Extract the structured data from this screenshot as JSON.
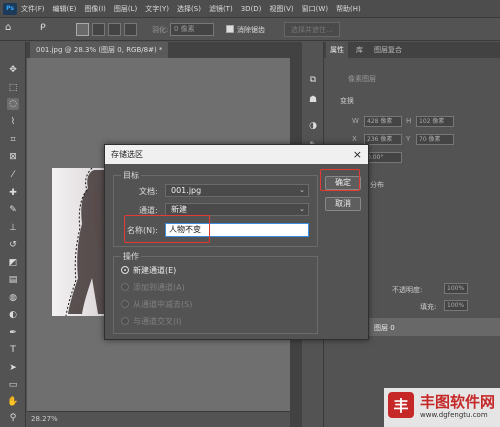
{
  "app": {
    "logo": "Ps",
    "menu": [
      "文件(F)",
      "编辑(E)",
      "图像(I)",
      "图层(L)",
      "文字(Y)",
      "选择(S)",
      "滤镜(T)",
      "3D(D)",
      "视图(V)",
      "窗口(W)",
      "帮助(H)"
    ]
  },
  "options_bar": {
    "feather_label": "羽化:",
    "feather_value": "0 像素",
    "antialias_label": "消除锯齿",
    "antialias_checked": true,
    "select_subject_label": "选择并遮住..."
  },
  "document": {
    "tab_title": "001.jpg @ 28.3% (图层 0, RGB/8#) *",
    "zoom": "28.27%"
  },
  "right_panel": {
    "tabs": [
      "属性",
      "库",
      "图层复合"
    ],
    "pixel_layer_label": "像素图层",
    "transform_label": "变换",
    "w": "428 像素",
    "h": "102 像素",
    "x": "236 像素",
    "y": "70 像素",
    "angle": "0.00°",
    "align_label": "分布",
    "opacity_label": "不透明度:",
    "opacity_value": "100%",
    "fill_label": "填充:",
    "fill_value": "100%",
    "layer_name": "图层 0"
  },
  "dialog": {
    "title": "存储选区",
    "close_label": "×",
    "target_group": "目标",
    "doc_label": "文档:",
    "doc_value": "001.jpg",
    "channel_label": "通道:",
    "channel_value": "新建",
    "name_label": "名称(N):",
    "name_value": "人物不变",
    "ok_label": "确定",
    "cancel_label": "取消",
    "operation_group": "操作",
    "operations": [
      {
        "label": "新建通道(E)",
        "selected": true,
        "enabled": true
      },
      {
        "label": "添加到通道(A)",
        "selected": false,
        "enabled": false
      },
      {
        "label": "从通道中减去(S)",
        "selected": false,
        "enabled": false
      },
      {
        "label": "与通道交叉(I)",
        "selected": false,
        "enabled": false
      }
    ]
  },
  "watermark": {
    "logo_char": "丰",
    "title": "丰图软件网",
    "url": "www.dgfengtu.com"
  },
  "colors": {
    "accent": "#31a8ff",
    "highlight": "#e53935",
    "panel_bg": "#535353"
  }
}
